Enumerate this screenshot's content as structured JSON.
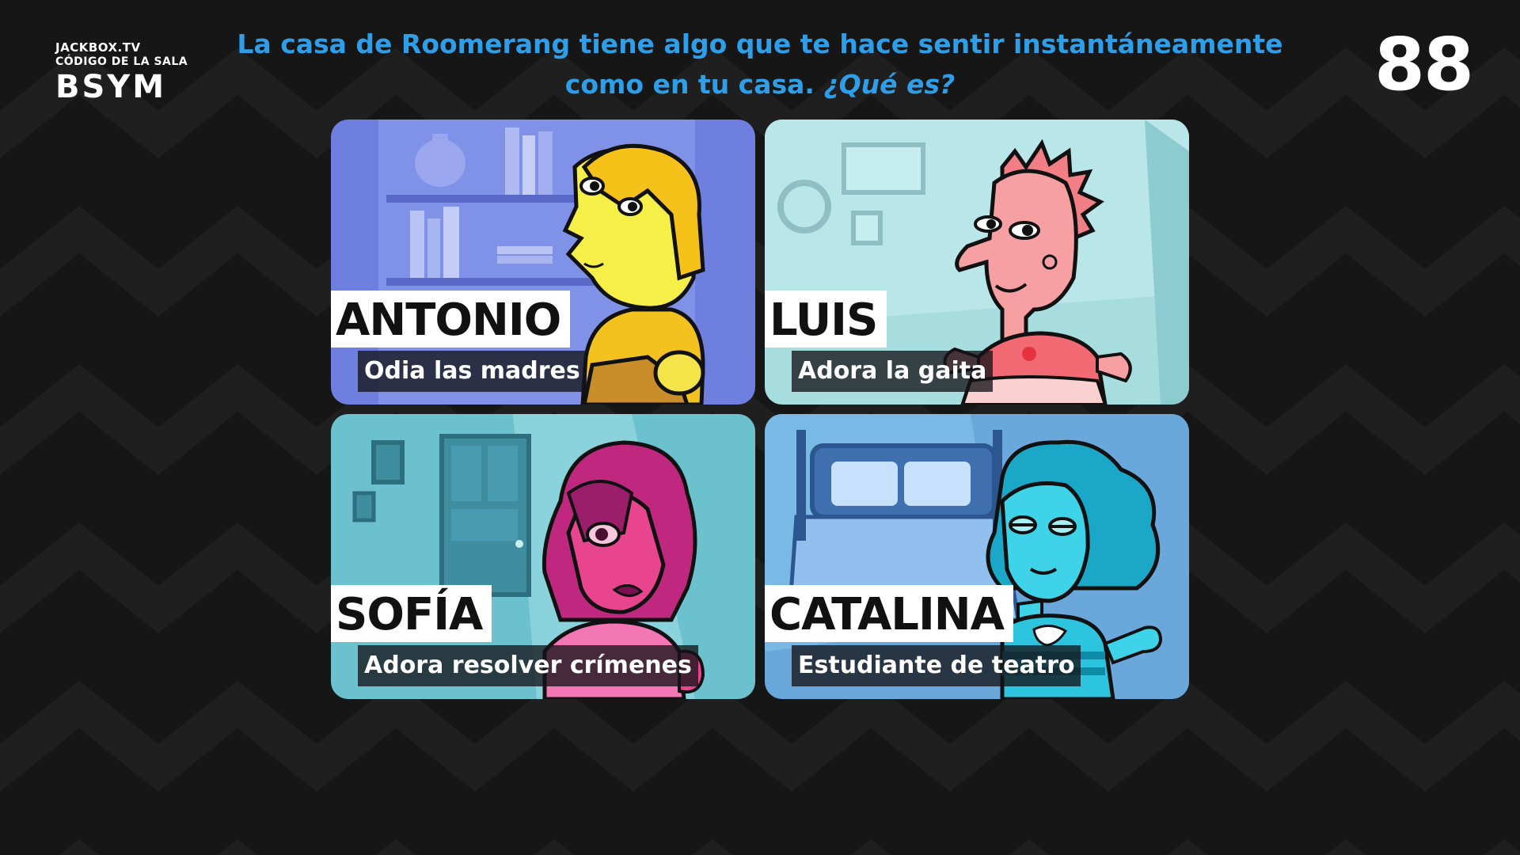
{
  "room": {
    "site": "JACKBOX.TV",
    "code_label": "CÓDIGO DE LA SALA",
    "code": "BSYM"
  },
  "prompt": {
    "line1": "La casa de Roomerang tiene algo que te hace sentir instantáneamente",
    "line2": "como en tu casa.",
    "question": "¿Qué es?"
  },
  "timer": {
    "value": "88"
  },
  "colors": {
    "background": "#161616",
    "prompt_text": "#2f9ee8",
    "antonio_bg": "#6f7fe0",
    "luis_bg": "#a8dde0",
    "sofia_bg": "#6cc1cf",
    "catalina_bg": "#6aa8dc"
  },
  "characters": [
    {
      "name": "ANTONIO",
      "trait": "Odia las madres",
      "icon": "antonio-avatar"
    },
    {
      "name": "LUIS",
      "trait": "Adora la gaita",
      "icon": "luis-avatar"
    },
    {
      "name": "SOFÍA",
      "trait": "Adora resolver crímenes",
      "icon": "sofia-avatar"
    },
    {
      "name": "CATALINA",
      "trait": "Estudiante de teatro",
      "icon": "catalina-avatar"
    }
  ]
}
